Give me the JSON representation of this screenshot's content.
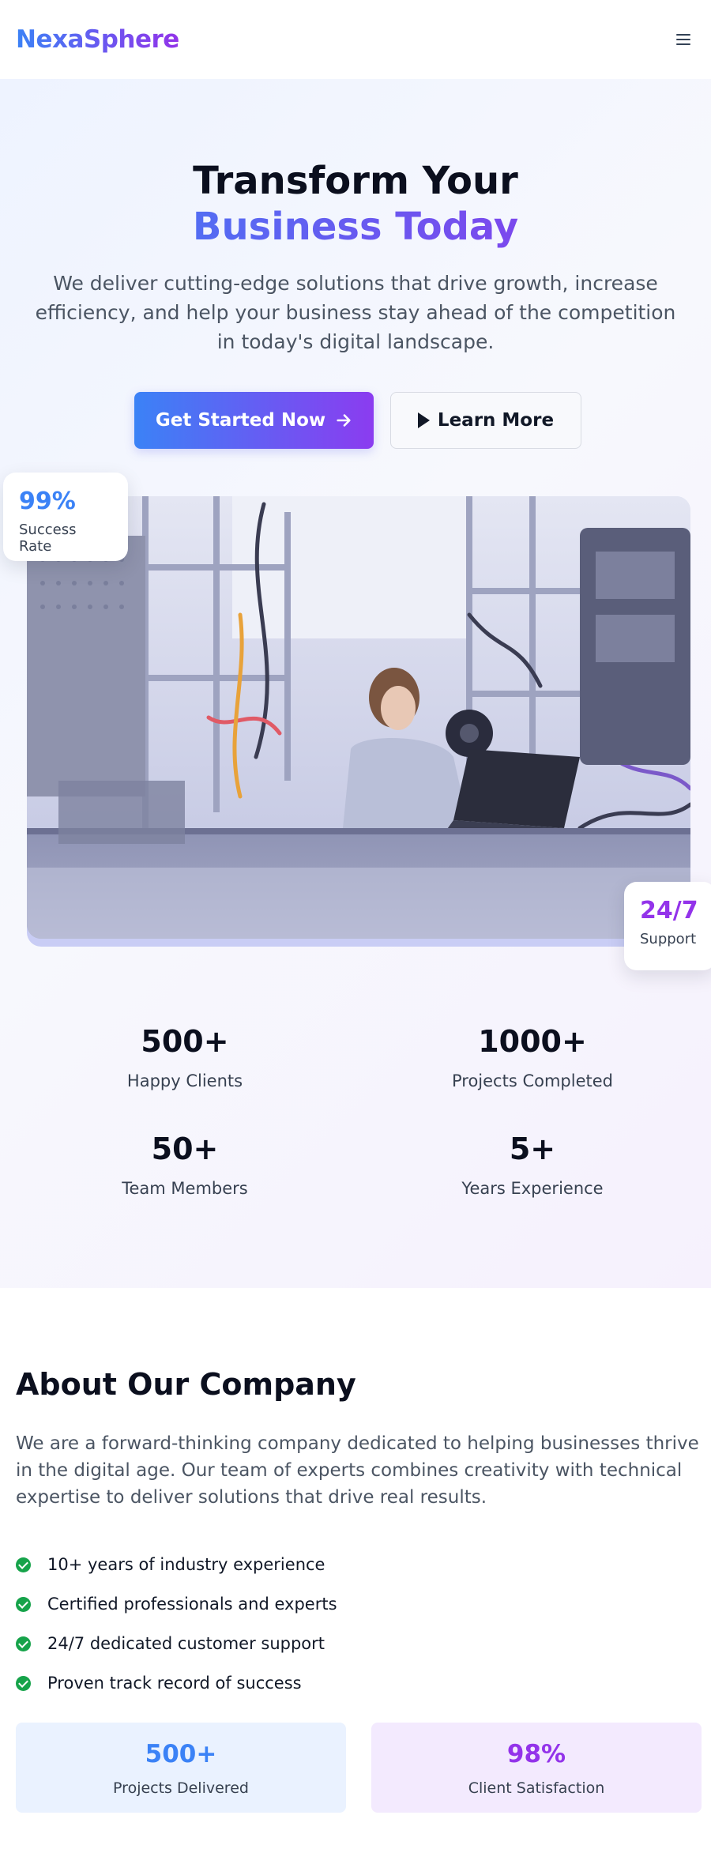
{
  "header": {
    "brand": "NexaSphere",
    "menu_icon": "hamburger-menu-icon"
  },
  "hero": {
    "title_line1": "Transform Your",
    "title_line2": "Business Today",
    "subtitle": "We deliver cutting-edge solutions that drive growth, increase efficiency, and help your business stay ahead of the competition in today's digital landscape.",
    "primary_button": "Get Started Now",
    "primary_button_icon": "arrow-right-icon",
    "secondary_button": "Learn More",
    "secondary_button_icon": "play-icon",
    "image_description": "Engineer working on a laptop in an electronics lab",
    "float_left": {
      "value": "99%",
      "label": "Success Rate"
    },
    "float_right": {
      "value": "24/7",
      "label": "Support"
    }
  },
  "stats": [
    {
      "value": "500+",
      "label": "Happy Clients"
    },
    {
      "value": "1000+",
      "label": "Projects Completed"
    },
    {
      "value": "50+",
      "label": "Team Members"
    },
    {
      "value": "5+",
      "label": "Years Experience"
    }
  ],
  "about": {
    "title": "About Our Company",
    "text": "We are a forward-thinking company dedicated to helping businesses thrive in the digital age. Our team of experts combines creativity with technical expertise to deliver solutions that drive real results.",
    "features": [
      "10+ years of industry experience",
      "Certified professionals and experts",
      "24/7 dedicated customer support",
      "Proven track record of success"
    ],
    "cards": [
      {
        "value": "500+",
        "label": "Projects Delivered"
      },
      {
        "value": "98%",
        "label": "Client Satisfaction"
      }
    ]
  },
  "colors": {
    "accent_blue": "#3b82f6",
    "accent_purple": "#9333ea",
    "check_green": "#16a34a"
  }
}
